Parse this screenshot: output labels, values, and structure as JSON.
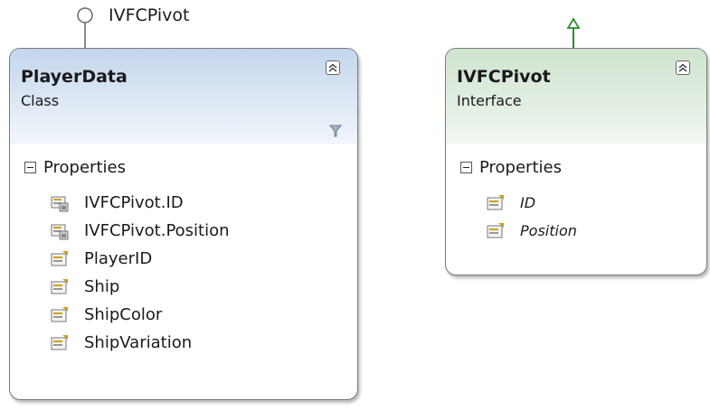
{
  "lollipop": {
    "label": "IVFCPivot"
  },
  "classes": [
    {
      "title": "PlayerData",
      "kind": "Class",
      "section": "Properties",
      "members": [
        "IVFCPivot.ID",
        "IVFCPivot.Position",
        "PlayerID",
        "Ship",
        "ShipColor",
        "ShipVariation"
      ],
      "header_color": "#c3d6ec"
    },
    {
      "title": "IVFCPivot",
      "kind": "Interface",
      "section": "Properties",
      "members": [
        "ID",
        "Position"
      ],
      "header_color": "#cfe3cf"
    }
  ],
  "colors": {
    "inherit_arrow": "#2e8b2e",
    "border": "#7b7b7b"
  }
}
